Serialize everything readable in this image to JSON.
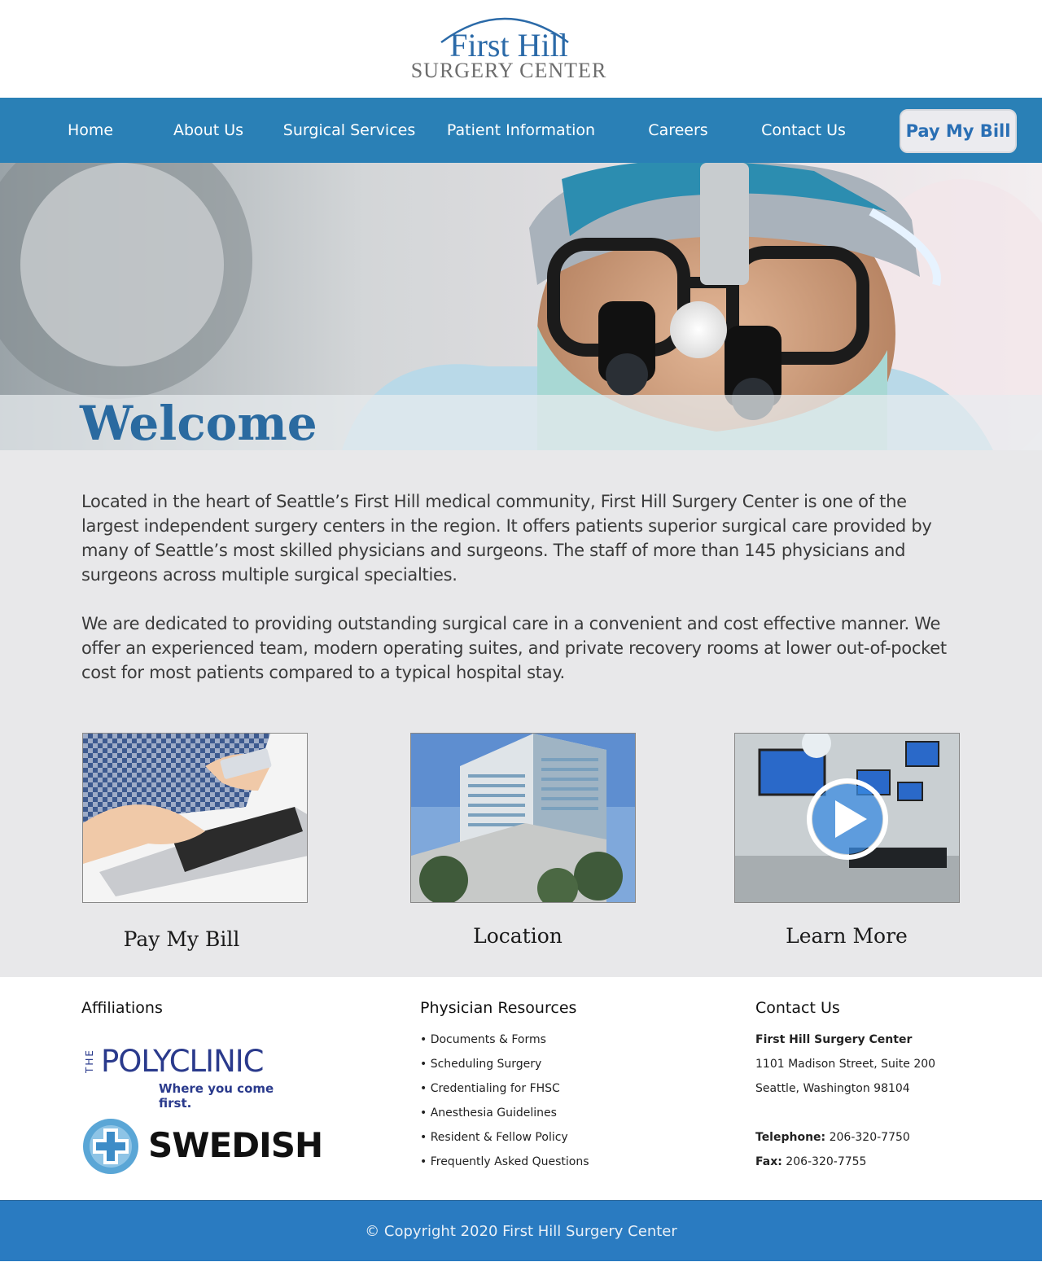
{
  "logo": {
    "line1": "First Hill",
    "line2": "SURGERY CENTER"
  },
  "nav": {
    "items": [
      {
        "label": "Home"
      },
      {
        "label": "About Us"
      },
      {
        "label": "Surgical Services"
      },
      {
        "label": "Patient Information"
      },
      {
        "label": "Careers"
      },
      {
        "label": "Contact Us"
      }
    ],
    "pay_button": "Pay My Bill"
  },
  "hero": {
    "heading": "Welcome"
  },
  "main": {
    "paragraphs": [
      "Located in the heart of Seattle’s First Hill medical community, First Hill Surgery Center is one of the largest independent surgery centers in the region. It offers patients superior surgical care provided by many of Seattle’s most skilled physicians and surgeons. The staff of more than 145 physicians and surgeons across multiple surgical specialties.",
      "We are dedicated to providing outstanding surgical care in a convenient and cost effective manner. We offer an experienced team, modern operating suites, and private recovery rooms at lower out-of-pocket cost for most patients compared to a typical hospital stay."
    ],
    "cards": [
      {
        "label": "Pay My Bill",
        "icon": "laptop-payment-image"
      },
      {
        "label": "Location",
        "icon": "building-image"
      },
      {
        "label": "Learn More",
        "icon": "operating-room-video-image"
      }
    ]
  },
  "footer": {
    "affiliations": {
      "heading": "Affiliations",
      "polyclinic": {
        "prefix": "THE",
        "name": "POLYCLINIC",
        "tagline": "Where you come first."
      },
      "swedish": {
        "name": "SWEDISH"
      }
    },
    "physician_resources": {
      "heading": "Physician Resources",
      "links": [
        "• Documents & Forms",
        "• Scheduling Surgery",
        "• Credentialing for FHSC",
        "• Anesthesia Guidelines",
        "• Resident & Fellow Policy",
        "• Frequently Asked Questions"
      ]
    },
    "contact": {
      "heading": "Contact Us",
      "name": "First Hill Surgery Center",
      "address1": "1101 Madison Street, Suite 200",
      "address2": "Seattle, Washington 98104",
      "telephone_label": "Telephone:",
      "telephone": "206-320-7750",
      "fax_label": "Fax:",
      "fax": "206-320-7755"
    }
  },
  "copyright": "© Copyright 2020 First Hill Surgery Center",
  "colors": {
    "nav": "#2a80b6",
    "accent": "#2a6aa0",
    "footer_bar": "#2a7bc1",
    "main_bg": "#e8e8ea"
  }
}
